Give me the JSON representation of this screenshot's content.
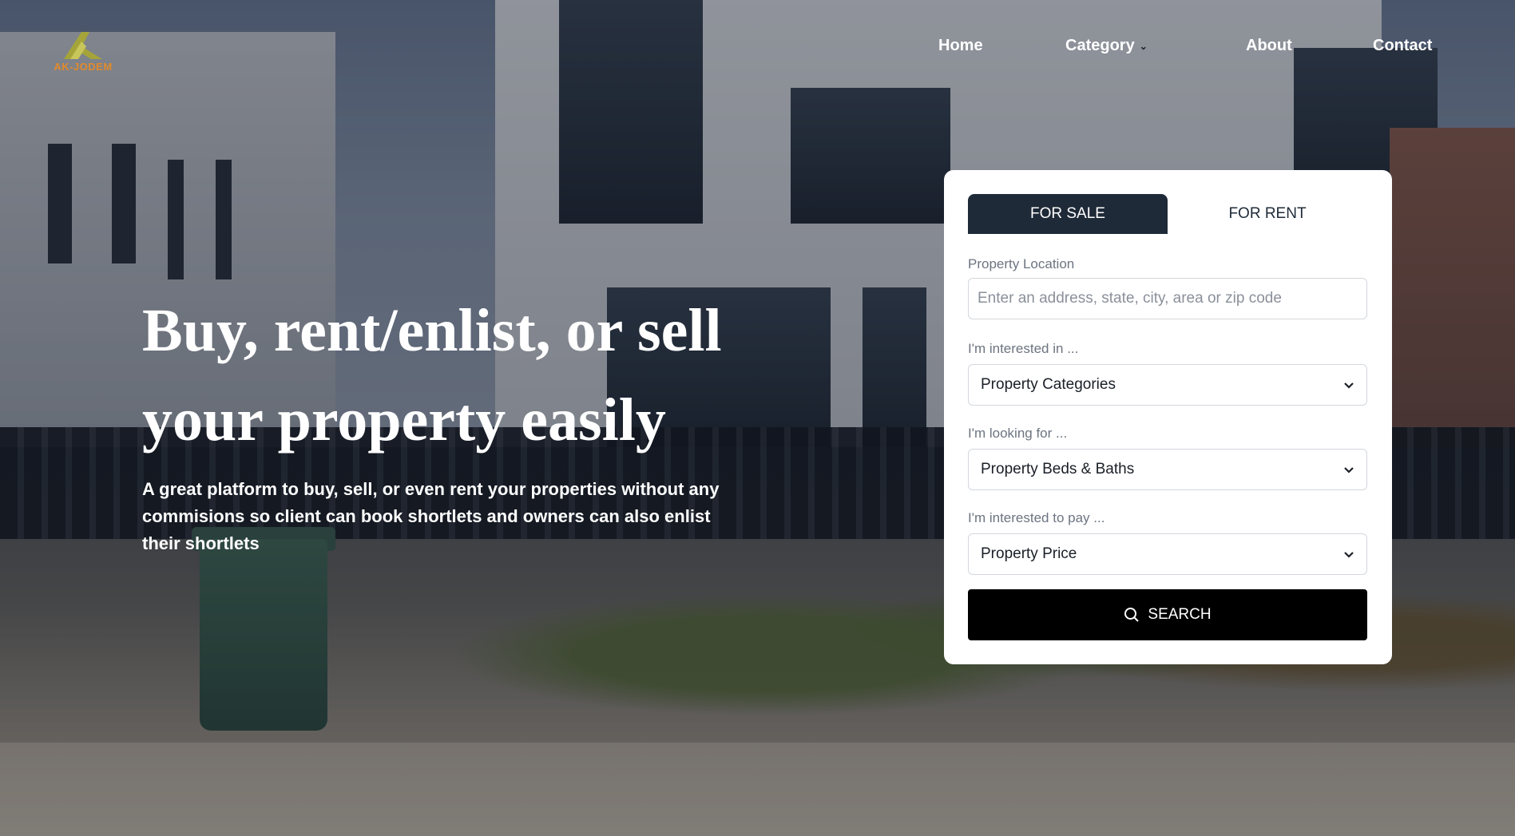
{
  "brand": {
    "logo_text": "AK-JODEM",
    "logo_color": "#e08a2c",
    "logo_mark_color": "#a4a43a"
  },
  "nav": {
    "items": [
      {
        "label": "Home"
      },
      {
        "label": "Category",
        "icon": "chevron-down-icon"
      },
      {
        "label": "About"
      },
      {
        "label": "Contact"
      }
    ]
  },
  "hero": {
    "headline_line1": "Buy, rent/enlist, or sell",
    "headline_line2": "your property easily",
    "subtext": "A great platform to buy, sell, or even rent your properties without any commisions so client can book shortlets and owners can also enlist their shortlets"
  },
  "search_card": {
    "tabs": [
      {
        "label": "FOR SALE",
        "active": true
      },
      {
        "label": "FOR RENT",
        "active": false
      }
    ],
    "location": {
      "label": "Property Location",
      "placeholder": "Enter an address, state, city, area or zip code",
      "value": ""
    },
    "category": {
      "label": "I'm interested in ...",
      "selected": "Property Categories"
    },
    "beds_baths": {
      "label": "I'm looking for ...",
      "selected": "Property Beds & Baths"
    },
    "price": {
      "label": "I'm interested to pay ...",
      "selected": "Property Price"
    },
    "search_button": {
      "label": "SEARCH",
      "icon": "search-icon"
    }
  },
  "colors": {
    "tab_active_bg": "#1f2a38",
    "search_button_bg": "#000000",
    "card_bg": "#ffffff"
  }
}
